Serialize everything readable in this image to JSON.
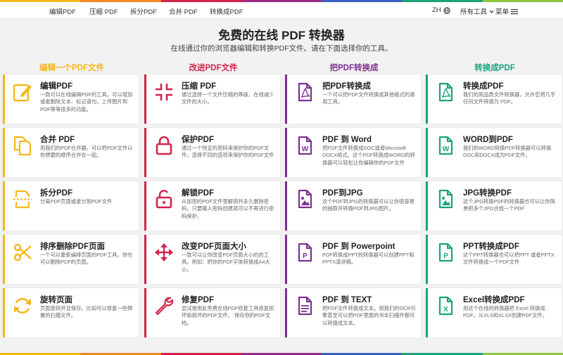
{
  "colors": {
    "yellow": "#f5b81c",
    "red": "#d2254b",
    "purple": "#7b3290",
    "green": "#1aa37b",
    "rainbow": [
      "#f5b81c",
      "#f08a24",
      "#d2254b",
      "#9c2a86",
      "#3c5fc4",
      "#1aa37b",
      "#8dc63f"
    ]
  },
  "nav": {
    "links": [
      "编辑PDF",
      "压缩 PDF",
      "拆分PDF",
      "合并 PDF",
      "转换成PDF"
    ],
    "lang": "ZH",
    "all_tools": "所有工具",
    "menu": "菜单"
  },
  "hero": {
    "title": "免费的在线 PDF 转换器",
    "subtitle": "在线通过你的浏览器编辑和转换PDF文件。请在下面选择你的工具。"
  },
  "columns": [
    {
      "heading": "编辑一个PDF文件",
      "color_key": "yellow",
      "cards": [
        {
          "icon": "edit-icon",
          "title": "编辑PDF",
          "desc": "一款可以在线编辑PDF的工具。可以增加或者删除文本、标记语句，上传图片到PDF等等很多的功能。"
        },
        {
          "icon": "copy-icon",
          "title": "合并 PDF",
          "desc": "用我们的PDF合并器，可以把PDF文件以你想要的顺序合并在一起。"
        },
        {
          "icon": "split-icon",
          "title": "拆分PDF",
          "desc": "分离PDF页面或者分割PDF文件"
        },
        {
          "icon": "scissors-icon",
          "title": "排序删除PDF页面",
          "desc": "一个可以重新编排页面的PDF工具。你也可以删除PDF的页面。"
        },
        {
          "icon": "rotate-icon",
          "title": "旋转页面",
          "desc": "页面旋转并且保存。比如可以修复一些倒置的扫描文件。"
        }
      ]
    },
    {
      "heading": "改进PDF文件",
      "color_key": "red",
      "cards": [
        {
          "icon": "compress-icon",
          "title": "压缩 PDF",
          "desc": "通过选择一个文件压缩的等级，在线减少文件的大小。"
        },
        {
          "icon": "lock-icon",
          "title": "保护PDF",
          "desc": "通过一个特定的密码来保护你的PDF文件。选择不同的选项来保护你的PDF文件"
        },
        {
          "icon": "unlock-icon",
          "title": "解锁PDF",
          "desc": "从加密的PDF文件里解锁并永久删除密码。只要输入密码创建就可以不再进行密码保护。"
        },
        {
          "icon": "move-icon",
          "title": "改变PDF页面大小",
          "desc": "一款可以让你改变PDF页面大小的的工具。例如：把你的PDF字体转换成A4大小。"
        },
        {
          "icon": "wrench-icon",
          "title": "修复PDF",
          "desc": "尝试使用此免费在线PDF修复工具修复损坏和损坏的PDF文件。 保存你的PDF文档。"
        }
      ]
    },
    {
      "heading": "把PDF转换成",
      "color_key": "purple",
      "cards": [
        {
          "icon": "pdf-file-icon",
          "title": "把PDF转换成",
          "desc": "一个可以把PDF文件转换成其他格式的通用工具。"
        },
        {
          "icon": "word-file-icon",
          "title": "PDF 到 Word",
          "desc": "把PDF文件转换成DOC或者Microsoft DOCX格式。这个PDF转换成WORD的转换器可以轻松让你编辑你的PDF文件"
        },
        {
          "icon": "image-file-icon",
          "title": "PDF到JPG",
          "desc": "这个PDF到JPG的转换器可以让你很容易的抽取并转换PDF到JPG图片。"
        },
        {
          "icon": "ppt-file-icon",
          "title": "PDF 到 Powerpoint",
          "desc": "PDF转换成PPT的转换器可以创建PPT和PPTX演讲稿。"
        },
        {
          "icon": "text-file-icon",
          "title": "PDF 到 TEXT",
          "desc": "把PDF文件转换成文本。用我们的OCR引擎甚至可以把PDF里面的书本扫描件都可以转换成文本。"
        }
      ]
    },
    {
      "heading": "转换成PDF",
      "color_key": "green",
      "cards": [
        {
          "icon": "pdf-file-icon",
          "title": "转换成PDF",
          "desc": "我们的高品质文件转换器，允许您将几乎任何文件转换为 PDF。"
        },
        {
          "icon": "word-file-icon",
          "title": "WORD到PDF",
          "desc": "我们的WORD转换PDF转换器可以转换DOC和DOCX成为PDF文件。"
        },
        {
          "icon": "image-file-icon",
          "title": "JPG转换PDF",
          "desc": "这个JPG转换PDF的转换器也可以让你简单把多个JPG合成一个PDF"
        },
        {
          "icon": "ppt-file-icon",
          "title": "PPT转换成PDF",
          "desc": "这个PPT转换器也可以把PPT 或者PPTX文件转换成一个PDF文件"
        },
        {
          "icon": "excel-file-icon",
          "title": "Excel转换成PDF",
          "desc": "用这个在线的转换器把 Excel 转换成PDF。从XLS和XLSX创建PDF文件。"
        }
      ]
    }
  ]
}
